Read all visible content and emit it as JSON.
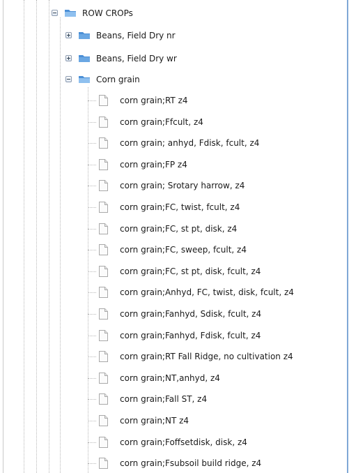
{
  "tree": {
    "root": {
      "label": "ROW CROPs",
      "expanded": true,
      "icon": "folder-open-icon"
    },
    "folders": [
      {
        "label": "Beans, Field Dry nr",
        "expanded": false,
        "icon": "folder-icon"
      },
      {
        "label": "Beans, Field Dry wr",
        "expanded": false,
        "icon": "folder-icon"
      },
      {
        "label": "Corn grain",
        "expanded": true,
        "icon": "folder-open-icon"
      }
    ],
    "items": [
      "corn grain;RT z4",
      "corn grain;Ffcult, z4",
      "corn grain; anhyd, Fdisk, fcult, z4",
      "corn grain;FP z4",
      "corn grain; Srotary harrow, z4",
      "corn grain;FC, twist, fcult, z4",
      "corn grain;FC, st pt, disk, z4",
      "corn grain;FC, sweep, fcult, z4",
      "corn grain;FC, st pt, disk, fcult, z4",
      "corn grain;Anhyd, FC, twist, disk, fcult, z4",
      "corn grain;Fanhyd, Sdisk, fcult, z4",
      "corn grain;Fanhyd, Fdisk, fcult, z4",
      "corn grain;RT Fall Ridge, no cultivation z4",
      "corn grain;NT,anhyd, z4",
      "corn grain;Fall ST, z4",
      "corn grain;NT z4",
      "corn grain;Foffsetdisk, disk, z4",
      "corn grain;Fsubsoil build ridge, z4"
    ],
    "item_icon": "document-icon"
  },
  "colors": {
    "folder": "#4b8fd6",
    "folder_light": "#8fc0ef",
    "frame_border": "#7fa8d6"
  }
}
